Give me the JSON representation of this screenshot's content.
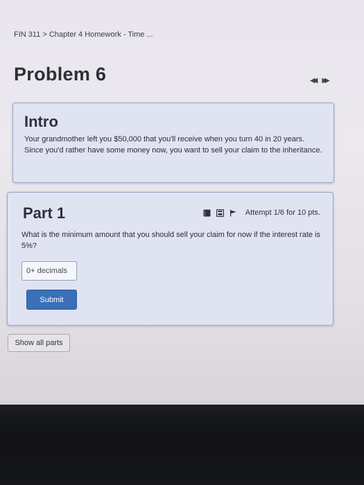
{
  "breadcrumb": "FIN 311 > Chapter 4 Homework - Time ...",
  "problem_title": "Problem 6",
  "nav": {
    "prev_icon": "double-left-arrow-icon",
    "next_icon": "double-right-arrow-icon",
    "prev_glyph": "◀◀",
    "next_glyph": "▶▶"
  },
  "intro": {
    "title": "Intro",
    "text": "Your grandmother left you $50,000 that you'll receive when you turn 40 in 20 years. Since you'd rather have some money now, you want to sell your claim to the inheritance."
  },
  "part": {
    "title": "Part 1",
    "attempt": "Attempt 1/6 for 10 pts.",
    "question": "What is the minimum amount that you should sell your claim for now if the interest rate is 5%?",
    "input_placeholder": "0+ decimals",
    "input_value": "",
    "submit_label": "Submit",
    "tool_icons": [
      "book-icon",
      "calculator-icon",
      "flag-icon"
    ]
  },
  "show_all_label": "Show all parts",
  "colors": {
    "primary_button": "#3b6fb8",
    "card_background": "#dfe3f2",
    "card_border": "#9aa6c6"
  }
}
